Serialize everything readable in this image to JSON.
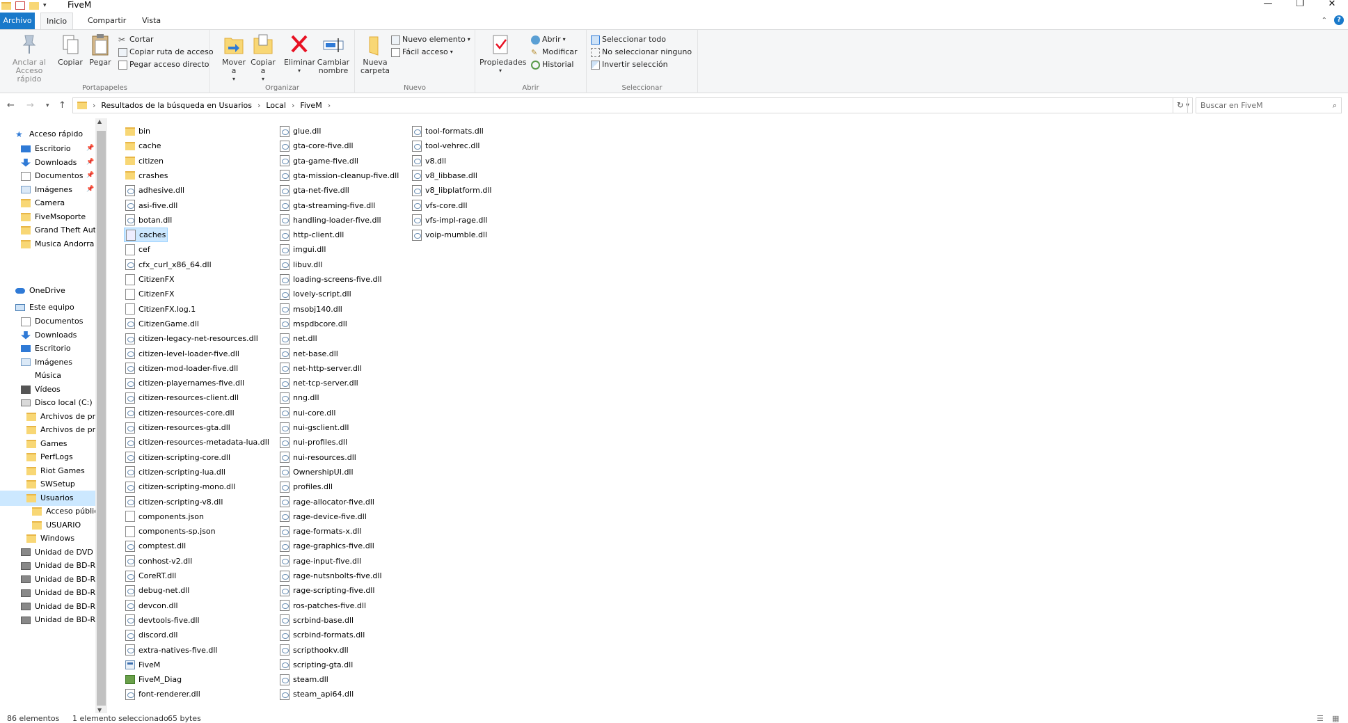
{
  "window": {
    "title": "FiveM"
  },
  "ribbon_tabs": {
    "file": "Archivo",
    "home": "Inicio",
    "share": "Compartir",
    "view": "Vista"
  },
  "clipboard": {
    "pin": "Anclar al Acceso rápido",
    "copy": "Copiar",
    "paste": "Pegar",
    "cut": "Cortar",
    "copy_path": "Copiar ruta de acceso",
    "paste_shortcut": "Pegar acceso directo",
    "group": "Portapapeles"
  },
  "organize": {
    "move": "Mover a",
    "copy_to": "Copiar a",
    "delete": "Eliminar",
    "rename": "Cambiar nombre",
    "group": "Organizar"
  },
  "new": {
    "new_folder": "Nueva carpeta",
    "new_item": "Nuevo elemento",
    "easy_access": "Fácil acceso",
    "group": "Nuevo"
  },
  "open": {
    "properties": "Propiedades",
    "open": "Abrir",
    "edit": "Modificar",
    "history": "Historial",
    "group": "Abrir"
  },
  "select": {
    "select_all": "Seleccionar todo",
    "select_none": "No seleccionar ninguno",
    "invert": "Invertir selección",
    "group": "Seleccionar"
  },
  "address": {
    "crumbs": [
      "Resultados de la búsqueda en Usuarios",
      "Local",
      "FiveM"
    ],
    "search_placeholder": "Buscar en FiveM"
  },
  "nav_pane": {
    "quick_access": "Acceso rápido",
    "qa_items": [
      "Escritorio",
      "Downloads",
      "Documentos",
      "Imágenes",
      "Camera",
      "FiveMsoporte",
      "Grand Theft Aut",
      "Musica Andorra"
    ],
    "onedrive": "OneDrive",
    "this_pc": "Este equipo",
    "pc_items": [
      "Documentos",
      "Downloads",
      "Escritorio",
      "Imágenes",
      "Música",
      "Vídeos",
      "Disco local (C:)"
    ],
    "c_items": [
      "Archivos de pr",
      "Archivos de pr",
      "Games",
      "PerfLogs",
      "Riot Games",
      "SWSetup",
      "Usuarios"
    ],
    "user_items": [
      "Acceso públic",
      "USUARIO"
    ],
    "windows": "Windows",
    "drives": [
      "Unidad de DVD",
      "Unidad de BD-R",
      "Unidad de BD-R",
      "Unidad de BD-R",
      "Unidad de BD-R",
      "Unidad de BD-RO"
    ]
  },
  "files": {
    "col1": [
      {
        "name": "bin",
        "kind": "folder"
      },
      {
        "name": "cache",
        "kind": "folder"
      },
      {
        "name": "citizen",
        "kind": "folder"
      },
      {
        "name": "crashes",
        "kind": "folder"
      },
      {
        "name": "adhesive.dll",
        "kind": "dll"
      },
      {
        "name": "asi-five.dll",
        "kind": "dll"
      },
      {
        "name": "botan.dll",
        "kind": "dll"
      },
      {
        "name": "caches",
        "kind": "caches"
      },
      {
        "name": "cef",
        "kind": "file"
      },
      {
        "name": "cfx_curl_x86_64.dll",
        "kind": "dll"
      },
      {
        "name": "CitizenFX",
        "kind": "file"
      },
      {
        "name": "CitizenFX",
        "kind": "file"
      },
      {
        "name": "CitizenFX.log.1",
        "kind": "file"
      },
      {
        "name": "CitizenGame.dll",
        "kind": "dll"
      },
      {
        "name": "citizen-legacy-net-resources.dll",
        "kind": "dll"
      },
      {
        "name": "citizen-level-loader-five.dll",
        "kind": "dll"
      },
      {
        "name": "citizen-mod-loader-five.dll",
        "kind": "dll"
      },
      {
        "name": "citizen-playernames-five.dll",
        "kind": "dll"
      },
      {
        "name": "citizen-resources-client.dll",
        "kind": "dll"
      },
      {
        "name": "citizen-resources-core.dll",
        "kind": "dll"
      },
      {
        "name": "citizen-resources-gta.dll",
        "kind": "dll"
      },
      {
        "name": "citizen-resources-metadata-lua.dll",
        "kind": "dll"
      },
      {
        "name": "citizen-scripting-core.dll",
        "kind": "dll"
      },
      {
        "name": "citizen-scripting-lua.dll",
        "kind": "dll"
      },
      {
        "name": "citizen-scripting-mono.dll",
        "kind": "dll"
      },
      {
        "name": "citizen-scripting-v8.dll",
        "kind": "dll"
      },
      {
        "name": "components.json",
        "kind": "json"
      },
      {
        "name": "components-sp.json",
        "kind": "json"
      },
      {
        "name": "comptest.dll",
        "kind": "dll"
      },
      {
        "name": "conhost-v2.dll",
        "kind": "dll"
      },
      {
        "name": "CoreRT.dll",
        "kind": "dll"
      },
      {
        "name": "debug-net.dll",
        "kind": "dll"
      },
      {
        "name": "devcon.dll",
        "kind": "dll"
      },
      {
        "name": "devtools-five.dll",
        "kind": "dll"
      },
      {
        "name": "discord.dll",
        "kind": "dll"
      },
      {
        "name": "extra-natives-five.dll",
        "kind": "dll"
      },
      {
        "name": "FiveM",
        "kind": "exe"
      },
      {
        "name": "FiveM_Diag",
        "kind": "diag"
      },
      {
        "name": "font-renderer.dll",
        "kind": "dll"
      }
    ],
    "col2": [
      "glue.dll",
      "gta-core-five.dll",
      "gta-game-five.dll",
      "gta-mission-cleanup-five.dll",
      "gta-net-five.dll",
      "gta-streaming-five.dll",
      "handling-loader-five.dll",
      "http-client.dll",
      "imgui.dll",
      "libuv.dll",
      "loading-screens-five.dll",
      "lovely-script.dll",
      "msobj140.dll",
      "mspdbcore.dll",
      "net.dll",
      "net-base.dll",
      "net-http-server.dll",
      "net-tcp-server.dll",
      "nng.dll",
      "nui-core.dll",
      "nui-gsclient.dll",
      "nui-profiles.dll",
      "nui-resources.dll",
      "OwnershipUI.dll",
      "profiles.dll",
      "rage-allocator-five.dll",
      "rage-device-five.dll",
      "rage-formats-x.dll",
      "rage-graphics-five.dll",
      "rage-input-five.dll",
      "rage-nutsnbolts-five.dll",
      "rage-scripting-five.dll",
      "ros-patches-five.dll",
      "scrbind-base.dll",
      "scrbind-formats.dll",
      "scripthookv.dll",
      "scripting-gta.dll",
      "steam.dll",
      "steam_api64.dll"
    ],
    "col3": [
      "tool-formats.dll",
      "tool-vehrec.dll",
      "v8.dll",
      "v8_libbase.dll",
      "v8_libplatform.dll",
      "vfs-core.dll",
      "vfs-impl-rage.dll",
      "voip-mumble.dll"
    ]
  },
  "status": {
    "count": "86 elementos",
    "selected": "1 elemento seleccionado",
    "size": "65 bytes"
  },
  "colors": {
    "accent": "#1979ca",
    "selection": "#cce8ff",
    "folder": "#f8d775",
    "delete_red": "#e81123"
  }
}
